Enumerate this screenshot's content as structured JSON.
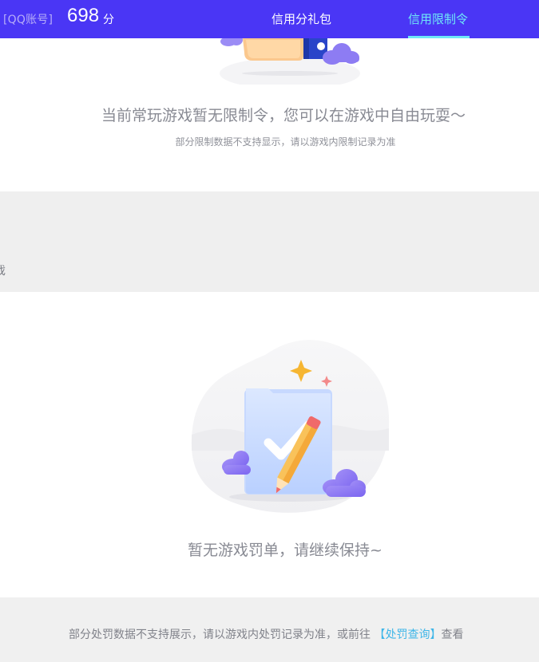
{
  "header": {
    "account_label": "[QQ账号]",
    "score": "698",
    "score_unit": "分",
    "tabs": [
      {
        "label": "信用分礼包",
        "active": false
      },
      {
        "label": "信用限制令",
        "active": true
      }
    ]
  },
  "limits": {
    "title": "当前常玩游戏暂无限制令，您可以在游戏中自由玩耍～",
    "subtitle": "部分限制数据不支持显示，请以游戏内限制记录为准"
  },
  "band": {
    "fragment": "戏"
  },
  "penalty": {
    "title": "暂无游戏罚单，请继续保持~"
  },
  "footer": {
    "prefix": "部分处罚数据不支持展示，请以游戏内处罚记录为准，或前往 ",
    "link": "【处罚查询】",
    "suffix": "查看"
  },
  "colors": {
    "header_bg": "#4a36f5",
    "active_tab": "#6ee8f7",
    "link": "#3fb6e8",
    "band_bg": "#efefef"
  },
  "icons": [
    "hand-icon",
    "cloud-icon",
    "folder-check-icon",
    "pencil-icon",
    "sparkle-icon"
  ]
}
